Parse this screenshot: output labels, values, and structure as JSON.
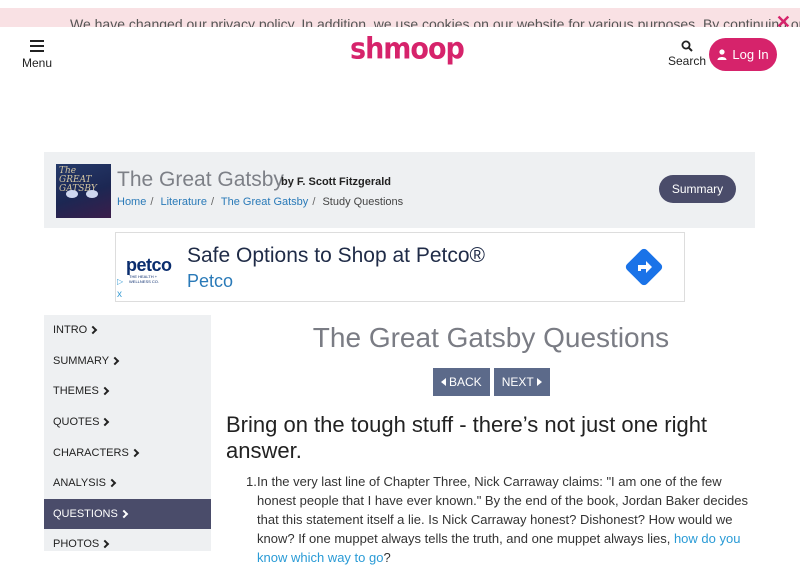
{
  "cookie": {
    "text": "We have changed our privacy policy. In addition, we use cookies on our website for various purposes. By continuing on our",
    "close": "✕"
  },
  "header": {
    "menu_label": "Menu",
    "logo": "shmoop",
    "search_label": "Search",
    "login_label": "Log In"
  },
  "book": {
    "cover_text": "The GREAT GATSBY",
    "title": "The Great Gatsby",
    "author": "by F. Scott Fitzgerald",
    "breadcrumbs": [
      "Home",
      "Literature",
      "The Great Gatsby",
      "Study Questions"
    ],
    "summary_button": "Summary"
  },
  "ad": {
    "logo": "petco",
    "logo_sub": "THE HEALTH + WELLNESS CO.",
    "headline": "Safe Options to Shop at Petco®",
    "brand": "Petco",
    "close": "x"
  },
  "sidebar": {
    "items": [
      {
        "label": "INTRO"
      },
      {
        "label": "SUMMARY"
      },
      {
        "label": "THEMES"
      },
      {
        "label": "QUOTES"
      },
      {
        "label": "CHARACTERS"
      },
      {
        "label": "ANALYSIS"
      },
      {
        "label": "QUESTIONS",
        "active": true
      },
      {
        "label": "PHOTOS"
      }
    ]
  },
  "main": {
    "title": "The Great Gatsby Questions",
    "back_label": "BACK",
    "next_label": "NEXT",
    "intro": "Bring on the tough stuff - there’s not just one right answer.",
    "questions": [
      {
        "number": "1.",
        "text": "In the very last line of Chapter Three, Nick Carraway claims: \"I am one of the few honest people that I have ever known.\" By the end of the book, Jordan Baker decides that this statement itself a lie. Is Nick Carraway honest? Dishonest? How would we know? If one muppet always tells the truth, and one muppet always lies, ",
        "link": "how do you know which way to go",
        "tail": "?"
      }
    ]
  },
  "colors": {
    "brand_pink": "#d6236b",
    "nav_active": "#4a4c6a",
    "pager_bg": "#5c6a8a",
    "link_blue": "#2a9bd6",
    "band_bg": "#eef0f2"
  }
}
